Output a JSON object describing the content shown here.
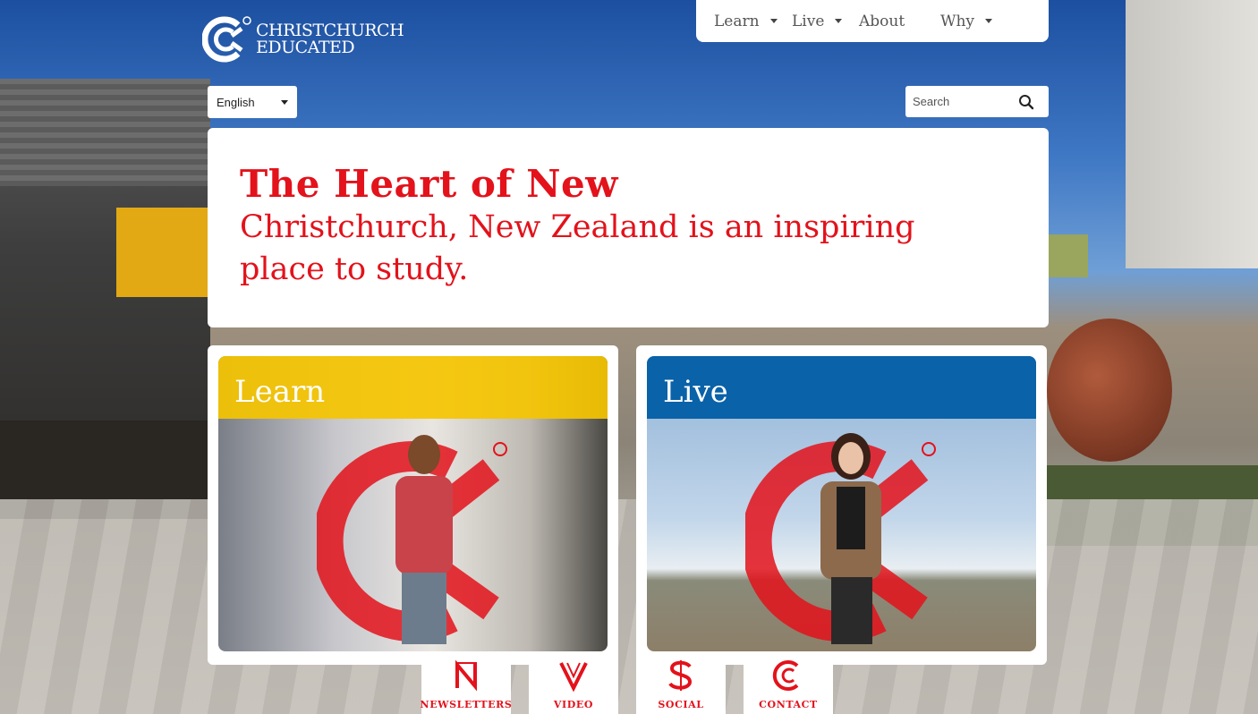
{
  "brand": {
    "line1": "CHRISTCHURCH",
    "line2": "EDUCATED",
    "icon": "christchurch-c-logo",
    "color": "#e3121b"
  },
  "nav": {
    "items": [
      {
        "label": "Learn",
        "has_dropdown": true
      },
      {
        "label": "Live",
        "has_dropdown": true
      },
      {
        "label": "About",
        "has_dropdown": false
      },
      {
        "label": "Why",
        "has_dropdown": true
      }
    ]
  },
  "language": {
    "selected": "English"
  },
  "search": {
    "placeholder": "Search",
    "icon": "search-icon"
  },
  "hero": {
    "headline": "The Heart of New",
    "body": "Christchurch, New Zealand is an inspiring place to study."
  },
  "cards": [
    {
      "title": "Learn",
      "band_color": "#f5c400"
    },
    {
      "title": "Live",
      "band_color": "#0a62a8"
    }
  ],
  "bottom_tabs": [
    {
      "label": "NEWSLETTERS",
      "icon": "newsletters-n-icon"
    },
    {
      "label": "VIDEO",
      "icon": "video-v-icon"
    },
    {
      "label": "SOCIAL",
      "icon": "social-s-icon"
    },
    {
      "label": "CONTACT",
      "icon": "contact-c-icon"
    }
  ]
}
